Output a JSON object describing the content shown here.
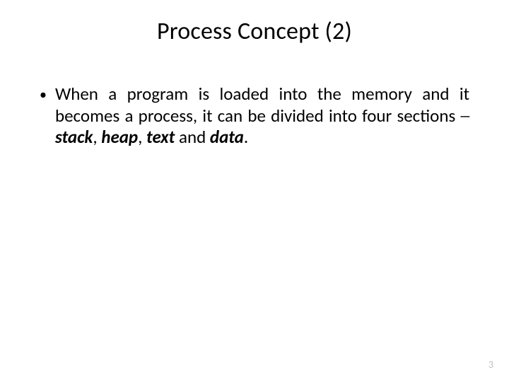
{
  "title": "Process Concept (2)",
  "bullet": {
    "pre": "When a program is loaded into the memory and it becomes a process, it can be divided into four sections ─ ",
    "kw1": "stack",
    "sep1": ", ",
    "kw2": "heap",
    "sep2": ", ",
    "kw3": "text",
    "sep3": " and ",
    "kw4": "data",
    "post": "."
  },
  "page_number": "3"
}
